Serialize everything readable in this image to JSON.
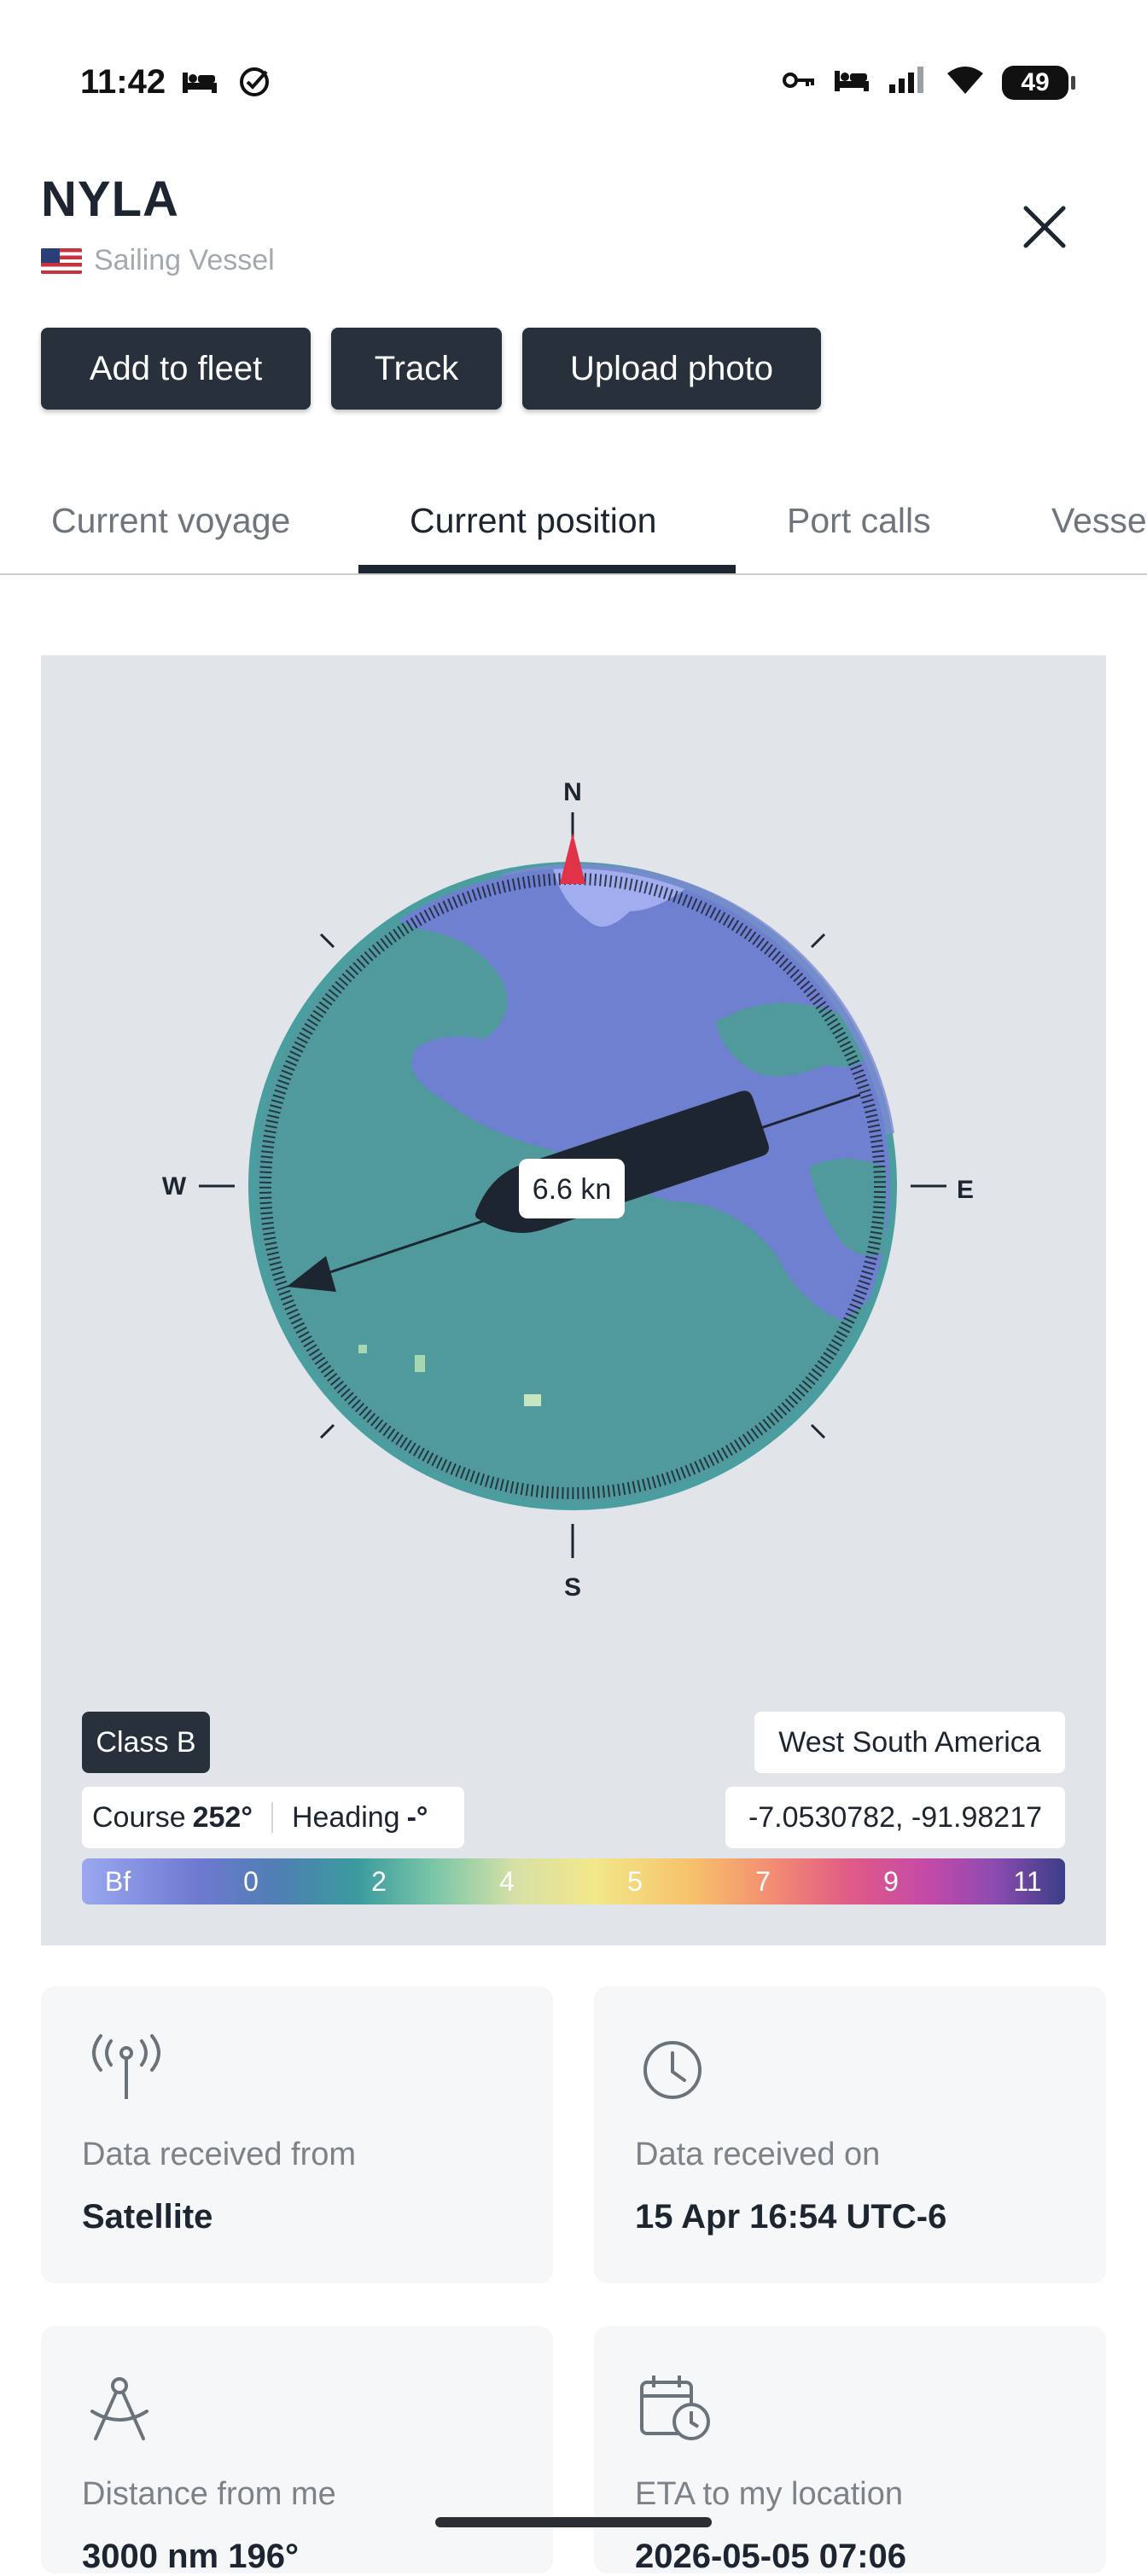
{
  "status_bar": {
    "time": "11:42",
    "left_icons": [
      "bed-icon",
      "check-circle-icon"
    ],
    "right_icons": [
      "key-icon",
      "bed-icon",
      "signal-icon",
      "wifi-icon"
    ],
    "battery": "49"
  },
  "header": {
    "vessel_name": "NYLA",
    "flag_icon": "us-flag-icon",
    "vessel_type": "Sailing Vessel"
  },
  "actions": {
    "add_to_fleet": "Add to fleet",
    "track": "Track",
    "upload_photo": "Upload photo"
  },
  "tabs": [
    {
      "label": "Current voyage",
      "active": false
    },
    {
      "label": "Current position",
      "active": true
    },
    {
      "label": "Port calls",
      "active": false
    },
    {
      "label": "Vessel",
      "active": false
    }
  ],
  "map": {
    "compass": {
      "n": "N",
      "s": "S",
      "e": "E",
      "w": "W"
    },
    "speed": "6.6 kn",
    "course_deg": 252,
    "class_badge": "Class B",
    "region": "West South America",
    "course_label": "Course",
    "course_value": "252°",
    "heading_label": "Heading",
    "heading_value": "-°",
    "coordinates": "-7.0530782, -91.98217",
    "beaufort_scale": [
      "Bf",
      "0",
      "2",
      "4",
      "5",
      "7",
      "9",
      "11"
    ]
  },
  "cards": [
    {
      "icon": "antenna-icon",
      "label": "Data received from",
      "value": "Satellite"
    },
    {
      "icon": "clock-icon",
      "label": "Data received on",
      "value": "15 Apr 16:54 UTC-6"
    },
    {
      "icon": "compass-drafting-icon",
      "label": "Distance from me",
      "value": "3000 nm 196°"
    },
    {
      "icon": "calendar-clock-icon",
      "label": "ETA to my location",
      "value": "2026-05-05 07:06"
    }
  ],
  "colors": {
    "primary_dark": "#28313b",
    "sea": "#6d7fcf",
    "land": "#4f9a9f",
    "north_marker": "#e0334a"
  }
}
